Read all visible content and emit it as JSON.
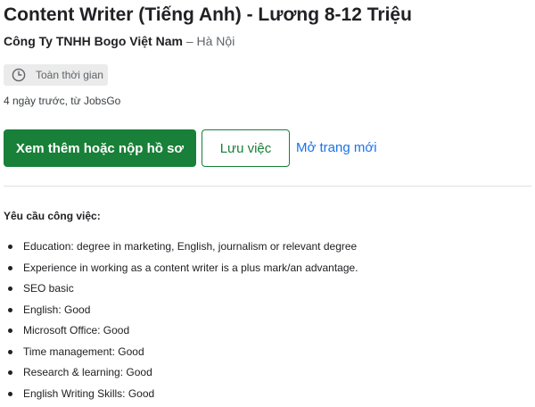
{
  "job": {
    "title": "Content Writer (Tiếng Anh) - Lương 8-12 Triệu",
    "company": "Công Ty TNHH Bogo Việt Nam",
    "separator": " – ",
    "location": "Hà Nội",
    "employment_type": "Toàn thời gian",
    "employment_type_icon": "clock-icon",
    "posted": "4 ngày trước, từ JobsGo"
  },
  "actions": {
    "apply_label": "Xem thêm hoặc nộp hồ sơ",
    "save_label": "Lưu việc",
    "open_new_label": "Mở trang mới"
  },
  "requirements": {
    "heading": "Yêu cầu công việc:",
    "items": [
      "Education: degree in marketing, English, journalism or relevant degree",
      "Experience in working as a content writer is a plus mark/an advantage.",
      "SEO basic",
      "English: Good",
      "Microsoft Office: Good",
      "Time management: Good",
      "Research & learning: Good",
      "English Writing Skills: Good"
    ]
  },
  "colors": {
    "primary_green": "#188038",
    "link_blue": "#1a73e8",
    "chip_bg": "#ebebeb",
    "muted_text": "#5f6368"
  }
}
